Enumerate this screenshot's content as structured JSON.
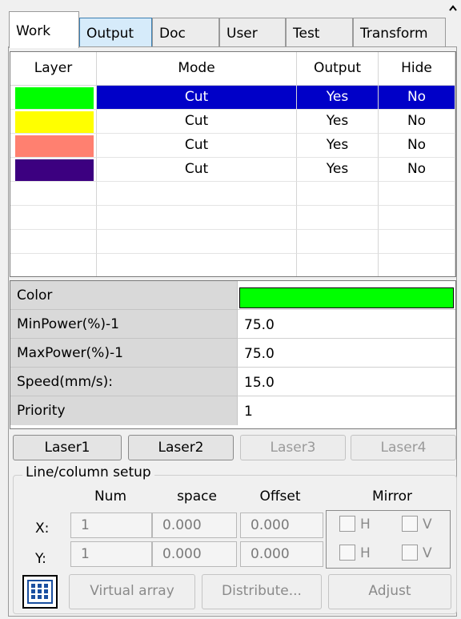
{
  "tabs": [
    "Work",
    "Output",
    "Doc",
    "User",
    "Test",
    "Transform"
  ],
  "layer_table": {
    "columns": [
      "Layer",
      "Mode",
      "Output",
      "Hide"
    ],
    "rows": [
      {
        "color": "#00ff00",
        "mode": "Cut",
        "output": "Yes",
        "hide": "No",
        "selected": true
      },
      {
        "color": "#ffff00",
        "mode": "Cut",
        "output": "Yes",
        "hide": "No"
      },
      {
        "color": "#ff8070",
        "mode": "Cut",
        "output": "Yes",
        "hide": "No"
      },
      {
        "color": "#3c0080",
        "mode": "Cut",
        "output": "Yes",
        "hide": "No"
      }
    ]
  },
  "properties": {
    "color_label": "Color",
    "color_value": "#00ff00",
    "minpower_label": "MinPower(%)-1",
    "minpower_value": "75.0",
    "maxpower_label": "MaxPower(%)-1",
    "maxpower_value": "75.0",
    "speed_label": "Speed(mm/s):",
    "speed_value": "15.0",
    "priority_label": "Priority",
    "priority_value": "1"
  },
  "lasers": [
    "Laser1",
    "Laser2",
    "Laser3",
    "Laser4"
  ],
  "line_column": {
    "legend": "Line/column setup",
    "headers": {
      "num": "Num",
      "space": "space",
      "offset": "Offset",
      "mirror": "Mirror"
    },
    "x": {
      "label": "X:",
      "num": "1",
      "space": "0.000",
      "offset": "0.000"
    },
    "y": {
      "label": "Y:",
      "num": "1",
      "space": "0.000",
      "offset": "0.000"
    },
    "mirror_h": "H",
    "mirror_v": "V",
    "virtual_array": "Virtual array",
    "distribute": "Distribute...",
    "adjust": "Adjust"
  },
  "icons": {
    "array": "array-grid-icon",
    "scroll": "chevron-up-icon"
  }
}
